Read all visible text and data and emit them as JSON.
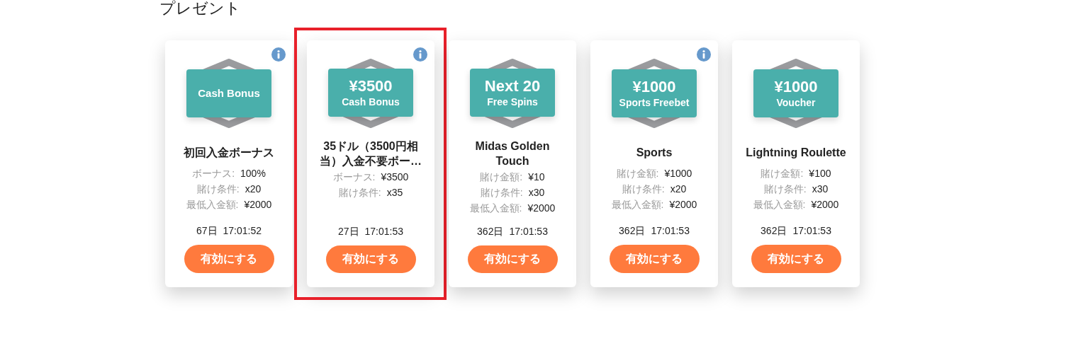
{
  "section_title": "プレゼント",
  "cards": [
    {
      "info": true,
      "highlighted": false,
      "badge": {
        "label": "Cash Bonus"
      },
      "title": "初回入金ボーナス",
      "details": [
        {
          "label": "ボーナス:",
          "value": "100%"
        },
        {
          "label": "賭け条件:",
          "value": "x20"
        },
        {
          "label": "最低入金額:",
          "value": "¥2000"
        }
      ],
      "days": "67日",
      "time": "17:01:52",
      "button": "有効にする"
    },
    {
      "info": true,
      "highlighted": true,
      "badge": {
        "amount": "¥3500",
        "label": "Cash Bonus"
      },
      "title": "35ドル（3500円相当）入金不要ボー…",
      "details": [
        {
          "label": "ボーナス:",
          "value": "¥3500"
        },
        {
          "label": "賭け条件:",
          "value": "x35"
        }
      ],
      "days": "27日",
      "time": "17:01:53",
      "button": "有効にする"
    },
    {
      "info": false,
      "highlighted": false,
      "badge": {
        "amount": "Next 20",
        "label": "Free Spins"
      },
      "title": "Midas Golden Touch",
      "details": [
        {
          "label": "賭け金額:",
          "value": "¥10"
        },
        {
          "label": "賭け条件:",
          "value": "x30"
        },
        {
          "label": "最低入金額:",
          "value": "¥2000"
        }
      ],
      "days": "362日",
      "time": "17:01:53",
      "button": "有効にする"
    },
    {
      "info": true,
      "highlighted": false,
      "badge": {
        "amount": "¥1000",
        "label": "Sports Freebet"
      },
      "title": "Sports",
      "details": [
        {
          "label": "賭け金額:",
          "value": "¥1000"
        },
        {
          "label": "賭け条件:",
          "value": "x20"
        },
        {
          "label": "最低入金額:",
          "value": "¥2000"
        }
      ],
      "days": "362日",
      "time": "17:01:53",
      "button": "有効にする"
    },
    {
      "info": false,
      "highlighted": false,
      "badge": {
        "amount": "¥1000",
        "label": "Voucher"
      },
      "title": "Lightning Roulette",
      "details": [
        {
          "label": "賭け金額:",
          "value": "¥100"
        },
        {
          "label": "賭け条件:",
          "value": "x30"
        },
        {
          "label": "最低入金額:",
          "value": "¥2000"
        }
      ],
      "days": "362日",
      "time": "17:01:53",
      "button": "有効にする"
    }
  ]
}
